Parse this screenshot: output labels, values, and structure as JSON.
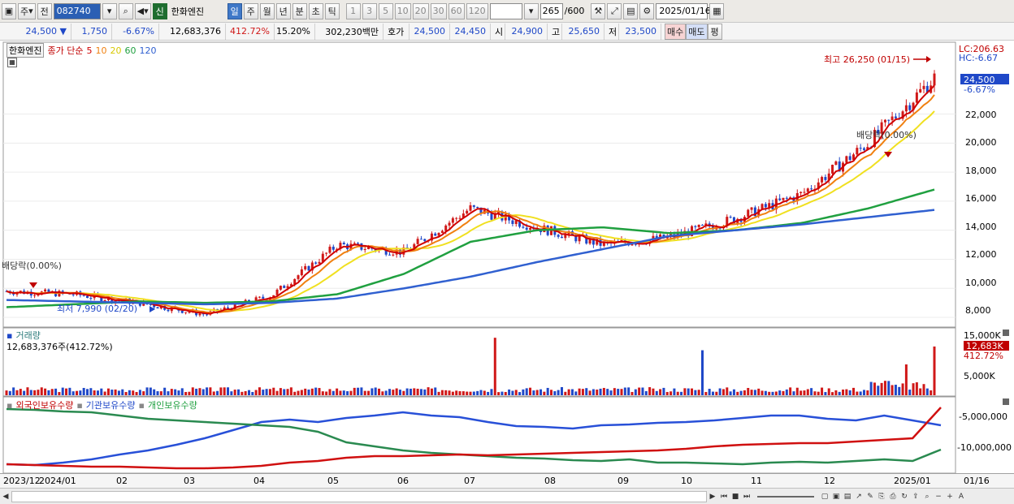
{
  "toolbar": {
    "type_label": "주",
    "prev_label": "전",
    "code": "082740",
    "badge_new": "신",
    "stock_name": "한화엔진",
    "periods": [
      "일",
      "주",
      "월",
      "년",
      "분",
      "초",
      "틱"
    ],
    "numbers": [
      "1",
      "3",
      "5",
      "10",
      "20",
      "30",
      "60",
      "120"
    ],
    "count": "265",
    "count_total": "/600",
    "date": "2025/01/16"
  },
  "info": {
    "price": "24,500",
    "change": "1,750",
    "change_pct": "-6.67%",
    "volume": "12,683,376",
    "volume_ratio": "412.72%",
    "turnover": "15.20%",
    "amount": "302,230백만",
    "ask_label": "호가",
    "ask": "24,500",
    "bid": "24,450",
    "open_label": "시",
    "open": "24,900",
    "high_label": "고",
    "high": "25,650",
    "low_label": "저",
    "low": "23,500",
    "buy_label": "매수",
    "sell_label": "매도",
    "avg_label": "평"
  },
  "price_panel": {
    "name_tag": "한화엔진",
    "legend_title": "종가 단순",
    "ma_periods": [
      "5",
      "10",
      "20",
      "60",
      "120"
    ],
    "lc": "LC:206.63",
    "hc": "HC:-6.67",
    "current_price": "24,500",
    "current_pct": "-6.67%",
    "high_note": "최고 26,250 (01/15)",
    "low_note": "최저 7,990 (02/20)",
    "dividend_note_1": "배당락(0.00%)",
    "dividend_note_2": "배당락(0.00%)",
    "y_ticks": [
      "22,000",
      "20,000",
      "18,000",
      "16,000",
      "14,000",
      "12,000",
      "10,000",
      "8,000"
    ]
  },
  "volume_panel": {
    "title": "거래량",
    "value_text": "12,683,376주(412.72%)",
    "y_ticks": [
      "15,000K",
      "5,000K"
    ],
    "current_value": "12,683K",
    "current_pct": "412.72%"
  },
  "holder_panel": {
    "legend_1": "외국인보유수량",
    "legend_2": "기관보유수량",
    "legend_3": "개인보유수량",
    "y_ticks": [
      "-5,000,000",
      "-10,000,000"
    ]
  },
  "x_axis": [
    "2023/12",
    "2024/01",
    "02",
    "03",
    "04",
    "05",
    "06",
    "07",
    "08",
    "09",
    "10",
    "11",
    "12",
    "2025/01",
    "01/16"
  ],
  "colors": {
    "ma5": "#d00000",
    "ma10": "#f08010",
    "ma20": "#f0e020",
    "ma60": "#20a040",
    "ma120": "#3060d0",
    "up": "#d01818",
    "down": "#1f48c8"
  },
  "chart_data": {
    "type": "line",
    "title": "",
    "x": [
      "2023/12",
      "2024/01",
      "02",
      "03",
      "04",
      "05",
      "06",
      "07",
      "08",
      "09",
      "10",
      "11",
      "12",
      "2025/01",
      "01/16"
    ],
    "series": [
      {
        "name": "종가",
        "values": [
          9800,
          9600,
          9000,
          8200,
          9500,
          13000,
          12500,
          15500,
          14200,
          13000,
          13500,
          14800,
          16500,
          20000,
          24500
        ]
      },
      {
        "name": "60",
        "values": [
          8700,
          8900,
          9100,
          9000,
          9100,
          9600,
          11000,
          13200,
          14000,
          14200,
          13800,
          14000,
          14500,
          15500,
          16800
        ]
      },
      {
        "name": "120",
        "values": [
          9200,
          9100,
          9000,
          8900,
          9000,
          9300,
          10000,
          10800,
          11800,
          12700,
          13600,
          14000,
          14400,
          14900,
          15400
        ]
      }
    ],
    "ylabel": "",
    "ylim": [
      7500,
      26500
    ]
  }
}
